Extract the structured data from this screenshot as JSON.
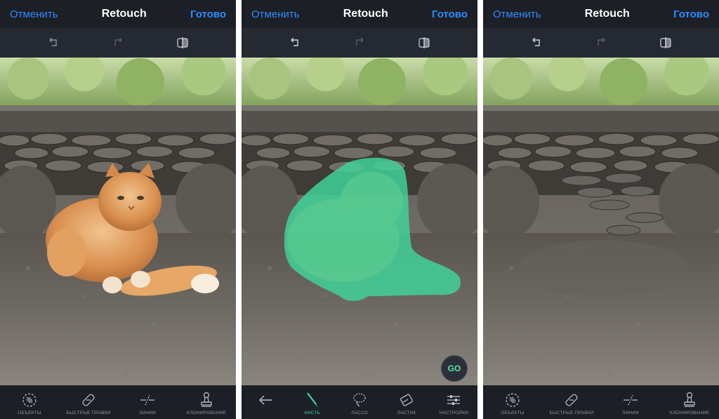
{
  "screens": [
    {
      "cancel_label": "Отменить",
      "title": "Retouch",
      "done_label": "Готово",
      "subbar_icons": [
        "undo-icon",
        "redo-icon",
        "compare-icon"
      ],
      "state": "original",
      "tools": [
        {
          "label": "ОБЪЕКТЫ",
          "icon": "objects-icon"
        },
        {
          "label": "БЫСТРЫЕ ПРАВКИ",
          "icon": "quick-fix-icon"
        },
        {
          "label": "ЛИНИИ",
          "icon": "lines-icon"
        },
        {
          "label": "КЛОНИРОВАНИЕ",
          "icon": "clone-stamp-icon"
        }
      ]
    },
    {
      "cancel_label": "Отменить",
      "title": "Retouch",
      "done_label": "Готово",
      "subbar_icons": [
        "undo-icon",
        "redo-icon",
        "compare-icon"
      ],
      "state": "selection",
      "go_label": "GO",
      "tools": [
        {
          "label": "",
          "icon": "back-arrow-icon"
        },
        {
          "label": "КИСТЬ",
          "icon": "brush-icon",
          "active": true
        },
        {
          "label": "ЛАССО",
          "icon": "lasso-icon"
        },
        {
          "label": "ЛАСТИК",
          "icon": "eraser-icon"
        },
        {
          "label": "НАСТРОЙКИ",
          "icon": "settings-sliders-icon"
        }
      ]
    },
    {
      "cancel_label": "Отменить",
      "title": "Retouch",
      "done_label": "Готово",
      "subbar_icons": [
        "undo-icon",
        "redo-icon",
        "compare-icon"
      ],
      "state": "removed",
      "tools": [
        {
          "label": "ОБЪЕКТЫ",
          "icon": "objects-icon"
        },
        {
          "label": "БЫСТРЫЕ ПРАВКИ",
          "icon": "quick-fix-icon"
        },
        {
          "label": "ЛИНИИ",
          "icon": "lines-icon"
        },
        {
          "label": "КЛОНИРОВАНИЕ",
          "icon": "clone-stamp-icon"
        }
      ]
    }
  ],
  "colors": {
    "accent": "#2f8bff",
    "selection": "#3fd69b",
    "background": "#1c1f26"
  }
}
